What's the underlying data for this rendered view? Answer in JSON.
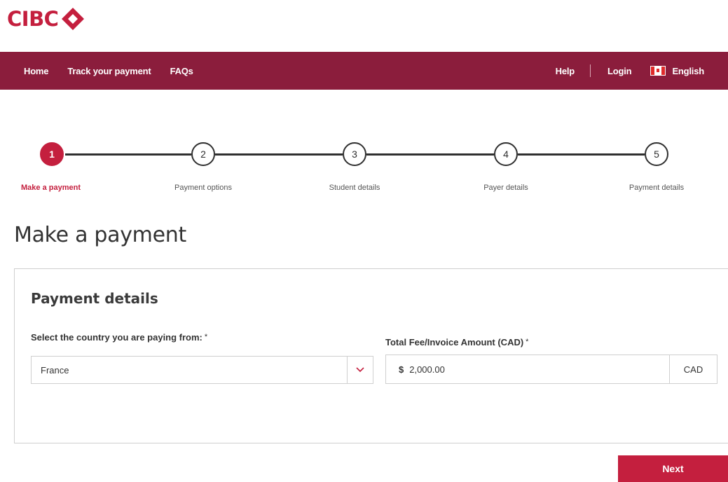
{
  "brand": {
    "logo_text": "CIBC",
    "accent_color": "#c41f3e",
    "nav_color": "#8b1d3c"
  },
  "nav": {
    "left": [
      "Home",
      "Track your payment",
      "FAQs"
    ],
    "help": "Help",
    "login": "Login",
    "language": "English"
  },
  "stepper": {
    "steps": [
      {
        "number": "1",
        "label": "Make a payment",
        "active": true
      },
      {
        "number": "2",
        "label": "Payment options",
        "active": false
      },
      {
        "number": "3",
        "label": "Student details",
        "active": false
      },
      {
        "number": "4",
        "label": "Payer details",
        "active": false
      },
      {
        "number": "5",
        "label": "Payment details",
        "active": false
      }
    ]
  },
  "page": {
    "title": "Make a payment"
  },
  "card": {
    "title": "Payment details",
    "country_label": "Select the country you are paying from:",
    "country_required": "*",
    "country_value": "France",
    "amount_label": "Total Fee/Invoice Amount (CAD)",
    "amount_required": "*",
    "currency_symbol": "$",
    "amount_value": "2,000.00",
    "currency_code": "CAD"
  },
  "actions": {
    "next_label": "Next"
  },
  "icons": {
    "caret": "chevron-down-icon",
    "flag": "canada-flag-icon",
    "logo_mark": "cibc-diamond-logo-icon"
  }
}
